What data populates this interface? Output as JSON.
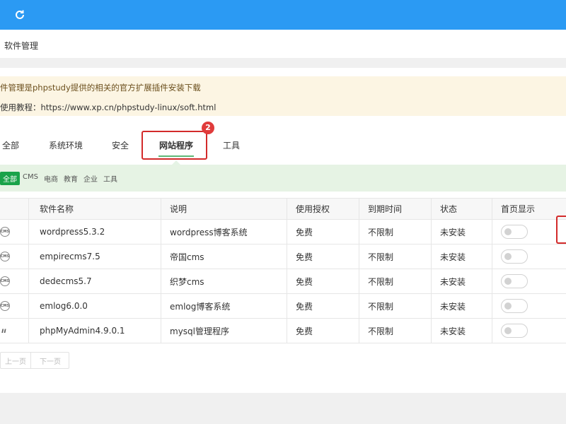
{
  "header": {
    "refresh_icon": "refresh-icon",
    "bg_color": "#2b9af3"
  },
  "title": "软件管理",
  "notice": {
    "line1": "件管理是phpstudy提供的相关的官方扩展插件安装下载",
    "line2": "使用教程：https://www.xp.cn/phpstudy-linux/soft.html"
  },
  "tabs": [
    {
      "label": "全部"
    },
    {
      "label": "系统环境"
    },
    {
      "label": "安全"
    },
    {
      "label": "网站程序",
      "active": true
    },
    {
      "label": "工具"
    }
  ],
  "badge": "2",
  "filters": [
    {
      "label": "全部",
      "active": true
    },
    {
      "label": "CMS"
    },
    {
      "label": "电商"
    },
    {
      "label": "教育"
    },
    {
      "label": "企业"
    },
    {
      "label": "工具"
    }
  ],
  "table": {
    "columns": [
      "软件名称",
      "说明",
      "使用授权",
      "到期时间",
      "状态",
      "首页显示"
    ],
    "rows": [
      {
        "icon": "cms-icon",
        "icon_text": "CMS",
        "name": "wordpress5.3.2",
        "desc": "wordpress博客系统",
        "license": "免费",
        "expire": "不限制",
        "status": "未安装",
        "homepage": false
      },
      {
        "icon": "cms-icon",
        "icon_text": "CMS",
        "name": "empirecms7.5",
        "desc": "帝国cms",
        "license": "免费",
        "expire": "不限制",
        "status": "未安装",
        "homepage": false
      },
      {
        "icon": "cms-icon",
        "icon_text": "CMS",
        "name": "dedecms5.7",
        "desc": "织梦cms",
        "license": "免费",
        "expire": "不限制",
        "status": "未安装",
        "homepage": false
      },
      {
        "icon": "cms-icon",
        "icon_text": "CMS",
        "name": "emlog6.0.0",
        "desc": "emlog博客系统",
        "license": "免费",
        "expire": "不限制",
        "status": "未安装",
        "homepage": false
      },
      {
        "icon": "phpmyadmin-icon",
        "icon_text": "pma",
        "name": "phpMyAdmin4.9.0.1",
        "desc": "mysql管理程序",
        "license": "免费",
        "expire": "不限制",
        "status": "未安装",
        "homepage": false
      }
    ]
  },
  "pager": {
    "prev": "上一页",
    "next": "下一页"
  },
  "colors": {
    "accent_blue": "#2b9af3",
    "active_green": "#1aa34a",
    "highlight_red": "#d32a2a",
    "notice_bg": "#fcf5e3",
    "filter_bg": "#e6f3e4"
  }
}
